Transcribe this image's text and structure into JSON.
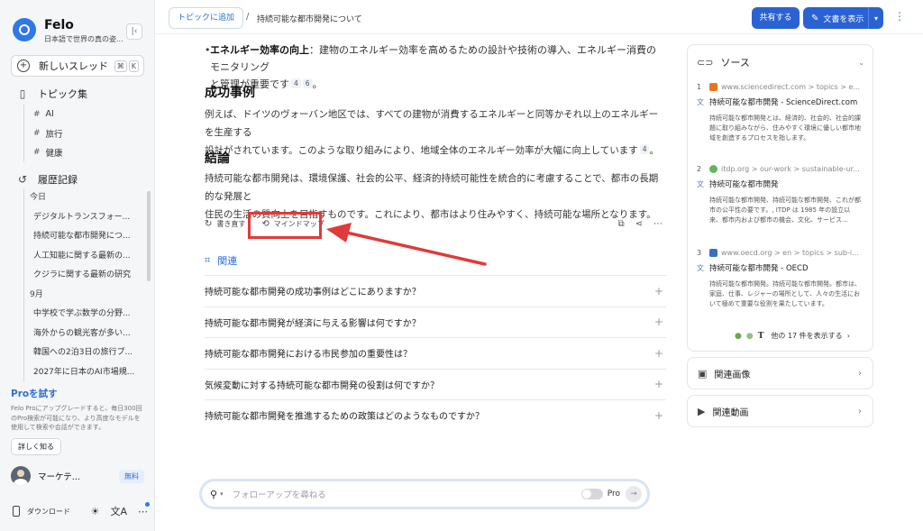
{
  "sidebar": {
    "brand_name": "Felo",
    "brand_sub": "日本語で世界の真の姿...",
    "new_thread_label": "新しいスレッド",
    "new_thread_keys": [
      "⌘",
      "K"
    ],
    "topics_label": "トピック集",
    "topics": [
      "AI",
      "旅行",
      "健康"
    ],
    "history_label": "履歴記録",
    "group_today": "今日",
    "today_items": [
      "デジタルトランスフォー...",
      "持続可能な都市開発につ...",
      "人工知能に関する最新の...",
      "クジラに関する最新の研究"
    ],
    "group_sep": "9月",
    "sep_items": [
      "中学校で学ぶ数学の分野...",
      "海外からの観光客が多い...",
      "韓国への2泊3日の旅行プ...",
      "2027年に日本のAI市場規..."
    ],
    "pro_title": "Proを試す",
    "pro_desc": "Felo Proにアップグレードすると、毎日300回のPro検索が可能になり、より高度なモデルを使用して検索や会話ができます。",
    "pro_button": "詳しく知る",
    "user_name": "マーケテ...",
    "plan_badge": "無料",
    "download_label": "ダウンロード"
  },
  "topbar": {
    "add_topic": "トピックに追加",
    "separator": "/",
    "breadcrumb": "持続可能な都市開発について",
    "share": "共有する",
    "show_doc": "文書を表示"
  },
  "content": {
    "bullet_bold": "エネルギー効率の向上",
    "bullet_text_1": "：建物のエネルギー効率を高めるための設計や技術の導入、エネルギー消費のモニタリング",
    "bullet_text_2": "と管理が重要です",
    "bullet_cites": [
      "4",
      "6"
    ],
    "bullet_end": "。",
    "h_success": "成功事例",
    "success_line1": "例えば、ドイツのヴォーバン地区では、すべての建物が消費するエネルギーと同等かそれ以上のエネルギーを生産する",
    "success_line2": "設計がされています。このような取り組みにより、地域全体のエネルギー効率が大幅に向上しています",
    "success_cite": "4",
    "success_end": "。",
    "h_conclusion": "結論",
    "conclusion_line1": "持続可能な都市開発は、環境保護、社会的公平、経済的持続可能性を統合的に考慮することで、都市の長期的な発展と",
    "conclusion_line2": "住民の生活の質向上を目指すものです。これにより、都市はより住みやすく、持続可能な場所となります。",
    "action_rewrite": "書き直す",
    "action_mindmap": "マインドマップ",
    "related_label": "関連",
    "questions": [
      "持続可能な都市開発の成功事例はどこにありますか？",
      "持続可能な都市開発が経済に与える影響は何ですか？",
      "持続可能な都市開発における市民参加の重要性は？",
      "気候変動に対する持続可能な都市開発の役割は何ですか？",
      "持続可能な都市開発を推進するための政策はどのようなものですか？"
    ]
  },
  "followup": {
    "placeholder": "フォローアップを尋ねる",
    "pro_label": "Pro"
  },
  "sources": {
    "title": "ソース",
    "items": [
      {
        "num": "1",
        "domain": "www.sciencedirect.com > topics > e...",
        "title": "持続可能な都市開発 - ScienceDirect.com",
        "desc": "持続可能な都市開発とは、経済的、社会的、社会的課題に取り組みながら、住みやすく環境に優しい都市地域を創造するプロセスを指します。",
        "fav_color": "#e8761f"
      },
      {
        "num": "2",
        "domain": "itdp.org > our-work > sustainable-ur...",
        "title": "持続可能な都市開発",
        "desc": "持続可能な都市開発、持続可能な都市開発、これが都市の公平性の要です。, ITDP は 1985 年の設立以来、都市内および都市の機会、文化、サービス...",
        "fav_color": "#5cb85c"
      },
      {
        "num": "3",
        "domain": "www.oecd.org > en > topics > sub-i...",
        "title": "持続可能な都市開発 - OECD",
        "desc": "持続可能な都市開発。持続可能な都市開発。都市は、家庭、仕事、レジャーの場所として、人々の生活において極めて重要な役割を果たしています。",
        "fav_color": "#3a6fc4"
      }
    ],
    "more_label": "他の 17 件を表示する"
  },
  "side_cards": {
    "images": "関連画像",
    "videos": "関連動画"
  },
  "colors": {
    "accent": "#2a62d4",
    "highlight": "#e03a3a"
  }
}
